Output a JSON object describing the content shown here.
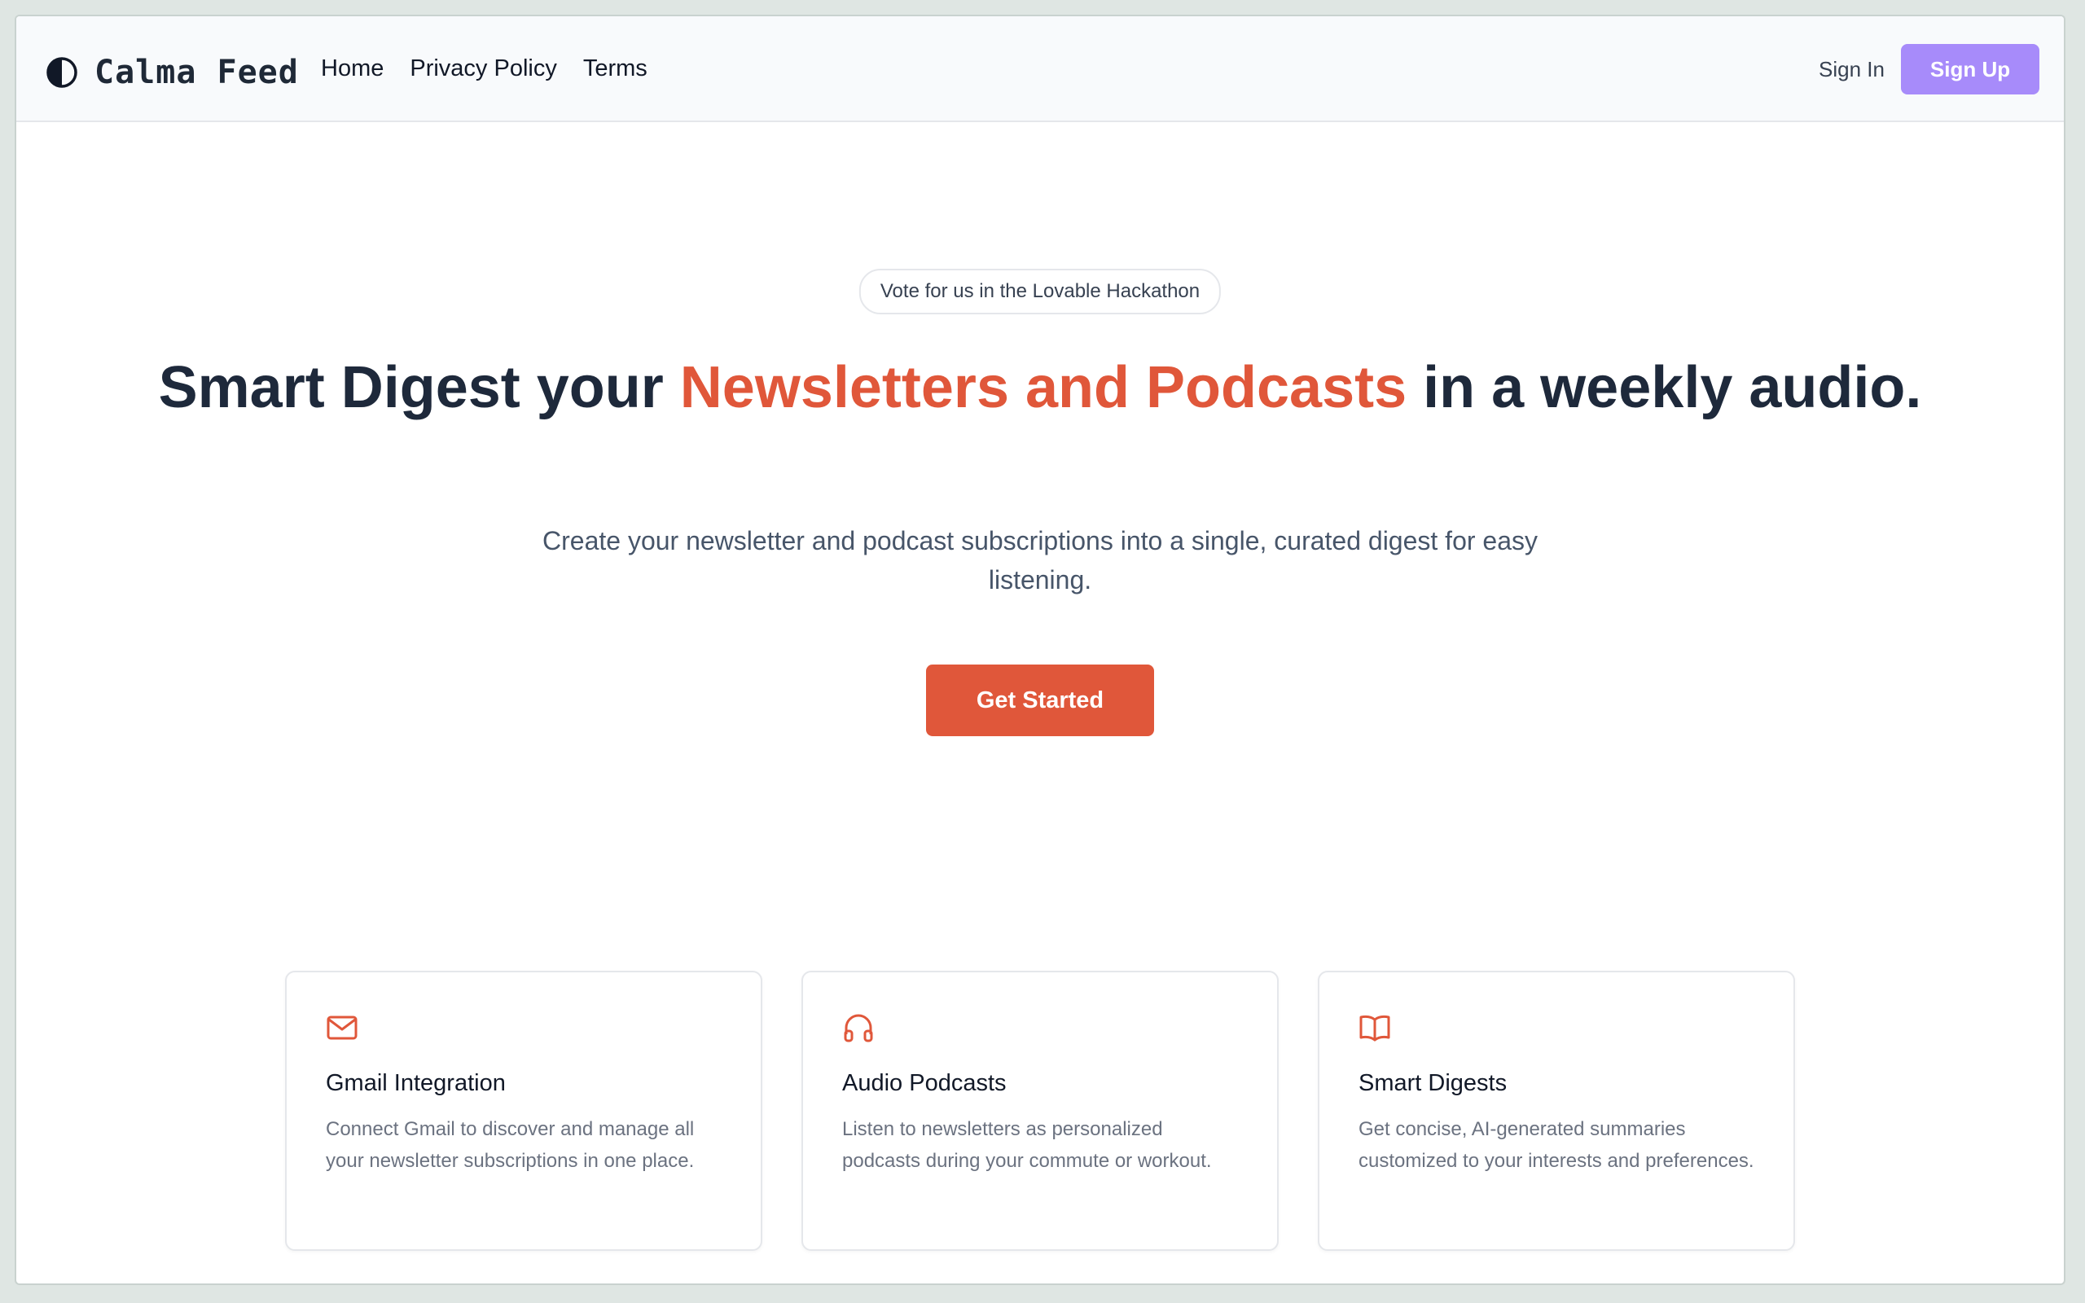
{
  "brand": {
    "name": "Calma Feed",
    "icon": "half-circle-icon"
  },
  "nav": {
    "links": [
      "Home",
      "Privacy Policy",
      "Terms"
    ]
  },
  "auth": {
    "signin_label": "Sign In",
    "signup_label": "Sign Up"
  },
  "hero": {
    "badge": "Vote for us in the Lovable Hackathon",
    "headline_pre": "Smart Digest your ",
    "headline_accent": "Newsletters and Podcasts",
    "headline_post": " in a weekly audio.",
    "subtitle": "Create your newsletter and podcast subscriptions into a single, curated digest for easy listening.",
    "cta_label": "Get Started"
  },
  "features": [
    {
      "icon": "mail-icon",
      "title": "Gmail Integration",
      "description": "Connect Gmail to discover and manage all your newsletter subscriptions in one place."
    },
    {
      "icon": "headphones-icon",
      "title": "Audio Podcasts",
      "description": "Listen to newsletters as personalized podcasts during your commute or workout."
    },
    {
      "icon": "book-open-icon",
      "title": "Smart Digests",
      "description": "Get concise, AI-generated summaries customized to your interests and preferences."
    }
  ],
  "colors": {
    "accent": "#e0573a",
    "signup": "#a78bfa",
    "heading": "#1e293b"
  }
}
